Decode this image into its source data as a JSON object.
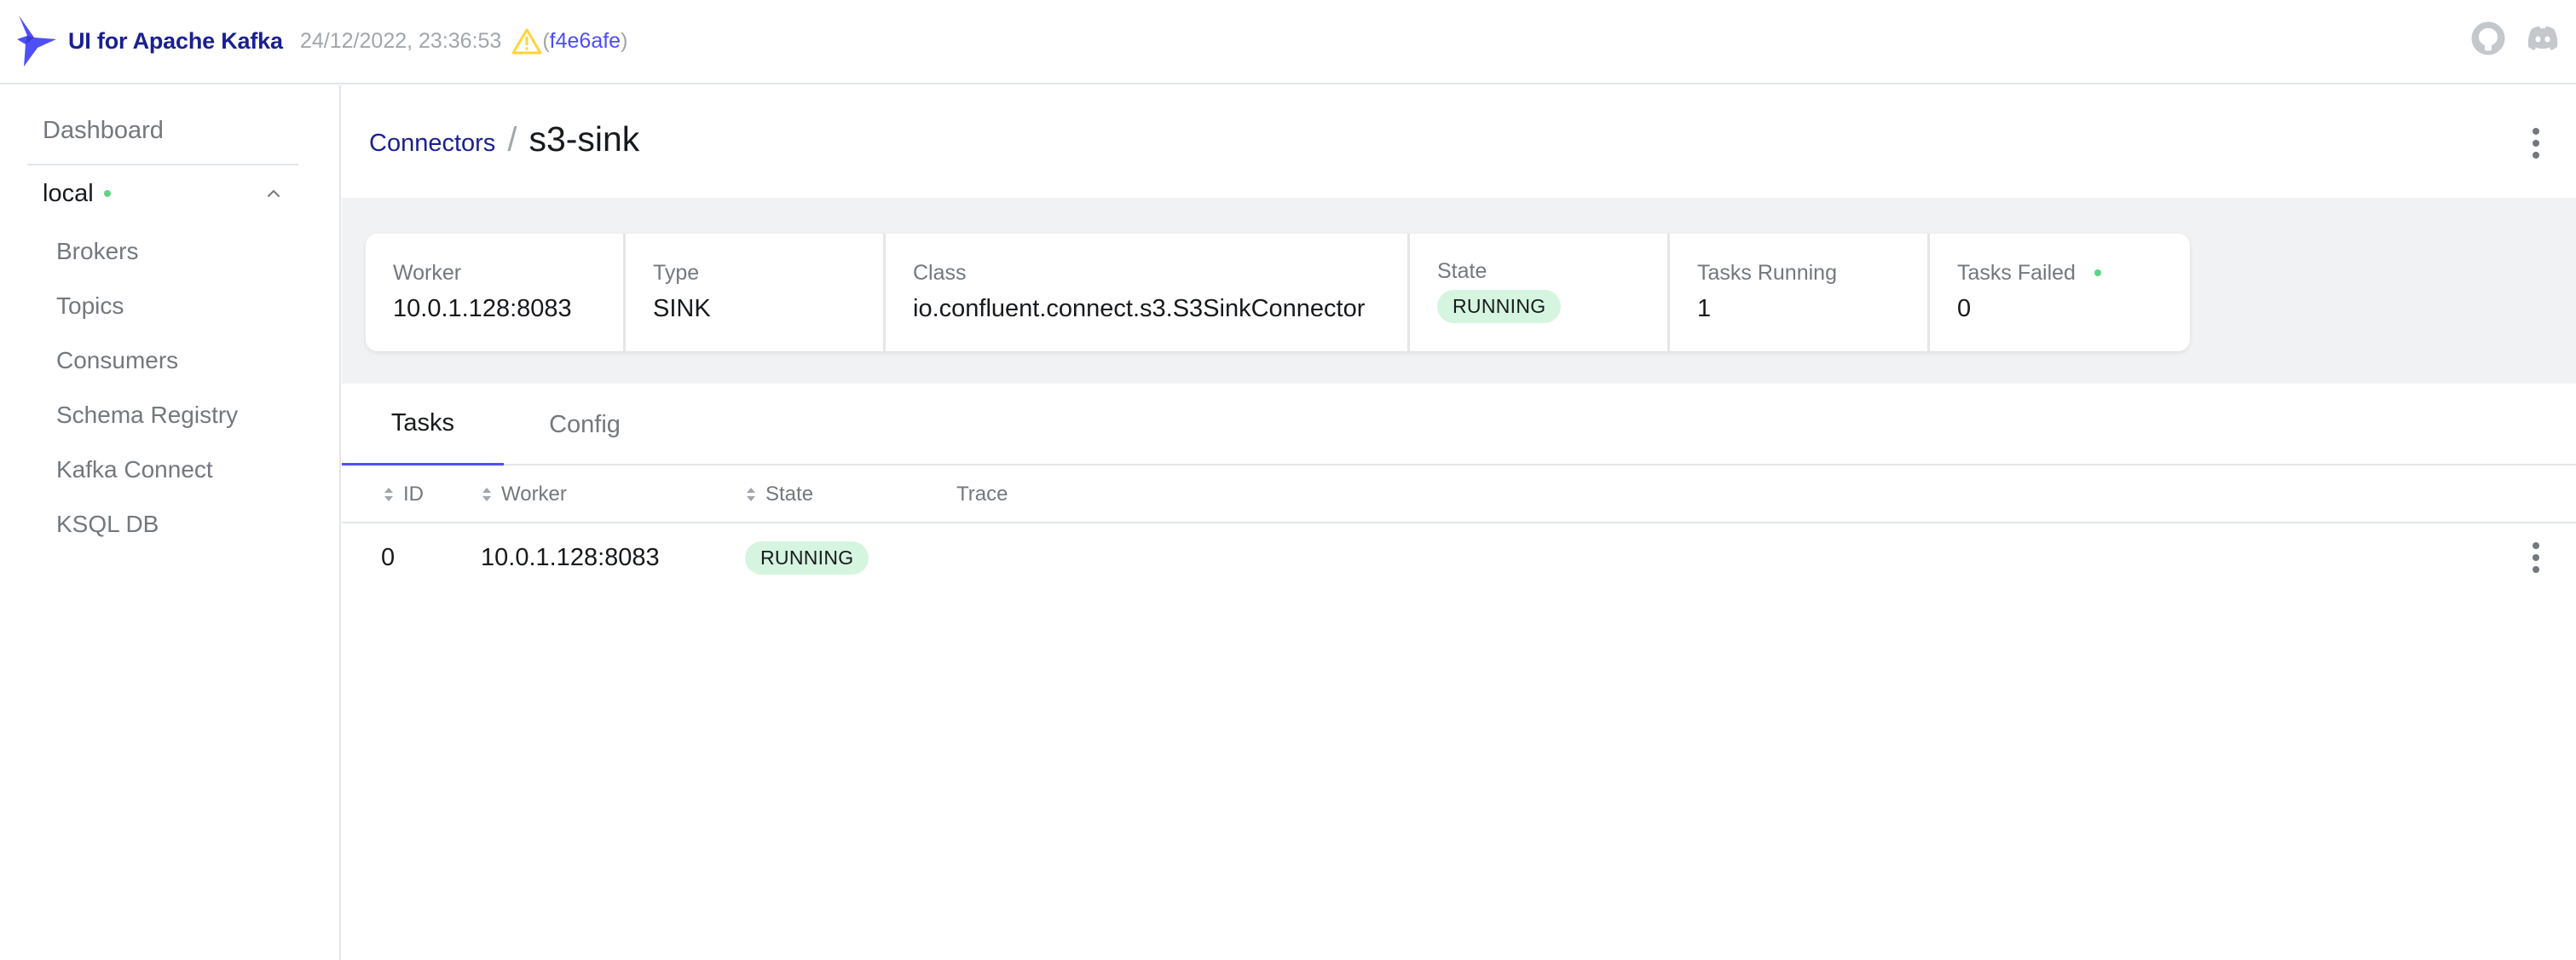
{
  "navbar": {
    "brand_title": "UI for Apache Kafka",
    "build_time": "24/12/2022, 23:36:53",
    "paren_open": "(",
    "commit": "f4e6afe",
    "paren_close": ")",
    "icons": [
      "github-icon",
      "discord-icon"
    ]
  },
  "sidebar": {
    "dashboard": "Dashboard",
    "cluster": {
      "name": "local",
      "status_color": "#5cd685"
    },
    "items": [
      {
        "label": "Brokers"
      },
      {
        "label": "Topics"
      },
      {
        "label": "Consumers"
      },
      {
        "label": "Schema Registry"
      },
      {
        "label": "Kafka Connect"
      },
      {
        "label": "KSQL DB"
      }
    ]
  },
  "page": {
    "breadcrumb_parent": "Connectors",
    "breadcrumb_sep": "/",
    "title": "s3-sink"
  },
  "metrics": [
    {
      "label": "Worker",
      "value": "10.0.1.128:8083"
    },
    {
      "label": "Type",
      "value": "SINK"
    },
    {
      "label": "Class",
      "value": "io.confluent.connect.s3.S3SinkConnector"
    },
    {
      "label": "State",
      "value": "RUNNING"
    },
    {
      "label": "Tasks Running",
      "value": "1"
    },
    {
      "label": "Tasks Failed",
      "value": "0"
    }
  ],
  "tabs": [
    {
      "label": "Tasks",
      "active": true
    },
    {
      "label": "Config",
      "active": false
    }
  ],
  "tasks_table": {
    "columns": [
      "ID",
      "Worker",
      "State",
      "Trace"
    ],
    "rows": [
      {
        "id": "0",
        "worker": "10.0.1.128:8083",
        "state": "RUNNING",
        "trace": ""
      }
    ]
  },
  "colors": {
    "brand": "#1a2091",
    "accent": "#4f4ffa",
    "running_badge_bg": "#d6f5e0",
    "status_dot": "#5cd685",
    "warning": "#ffd439"
  }
}
